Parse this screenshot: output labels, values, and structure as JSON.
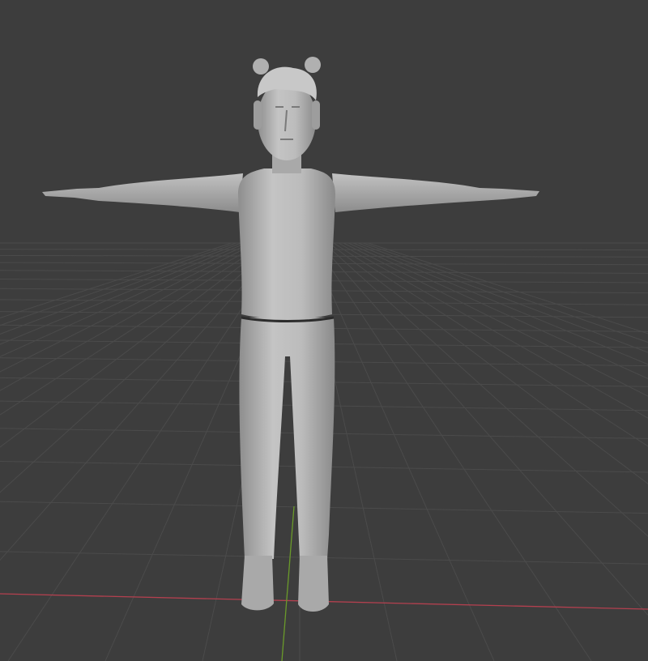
{
  "viewport": {
    "background_color": "#3d3d3d",
    "grid_color": "#4b4b4b",
    "x_axis_color": "#b3404f",
    "y_axis_color": "#6a9a2a",
    "model_color": "#b9b9b9"
  }
}
